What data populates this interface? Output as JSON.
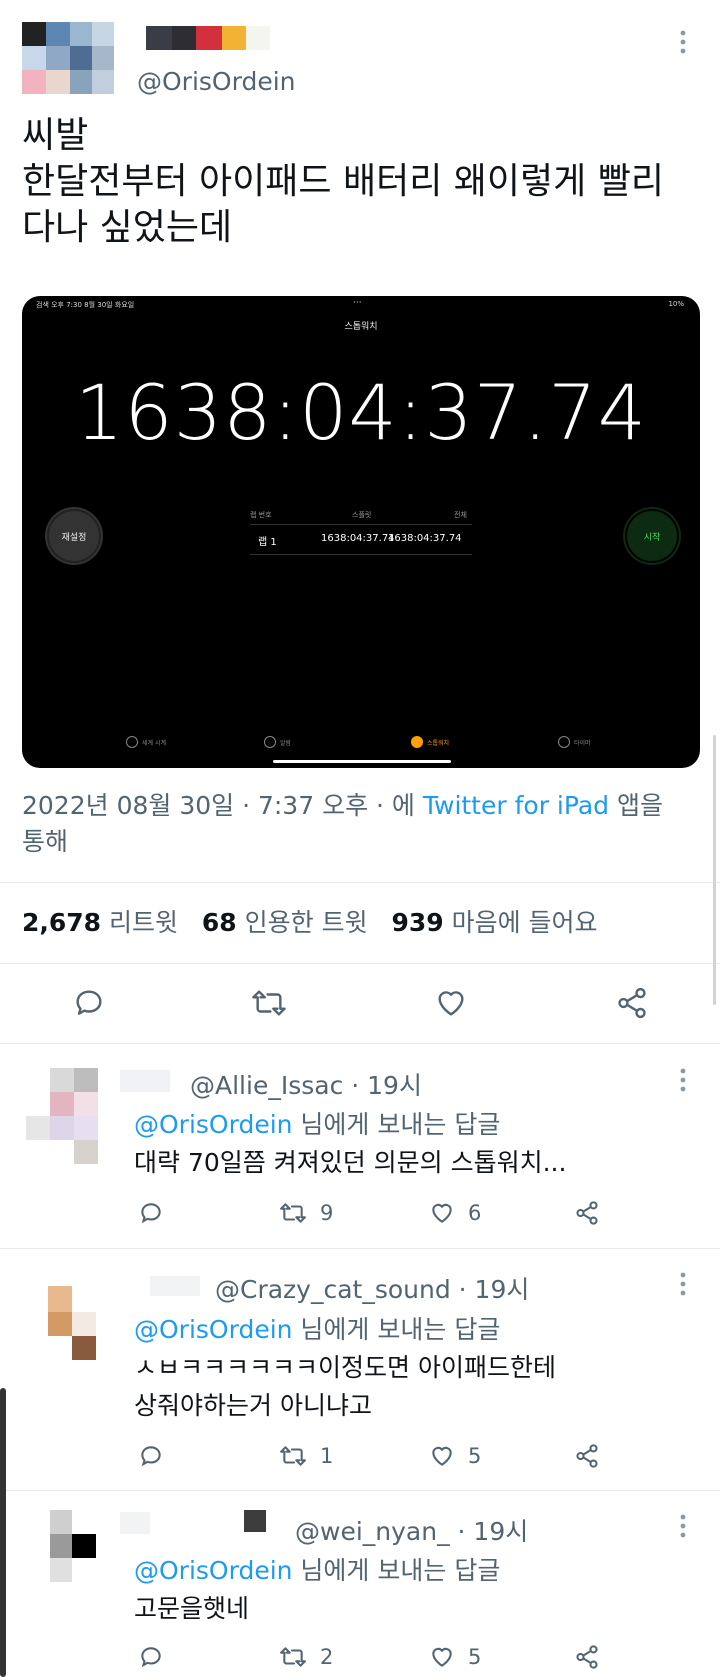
{
  "tweet": {
    "handle": "@OrisOrdein",
    "text_lines": [
      "씨발",
      "한달전부터 아이패드 배터리 왜이렇게 빨리",
      "다나 싶었는데"
    ],
    "media": {
      "status_left": "검색  오후 7:30  8월 30일 화요일",
      "status_center": "···",
      "status_right": "10%",
      "title": "스톱워치",
      "time": "1638:04:37.74",
      "reset_label": "재설정",
      "start_label": "시작",
      "lap_headers": [
        "랩 번호",
        "스플릿",
        "전체"
      ],
      "lap_row": {
        "lap": "랩 1",
        "split": "1638:04:37.74",
        "total": "1638:04:37.74"
      },
      "tabs": [
        {
          "label": "세계 시계",
          "icon": "globe-icon"
        },
        {
          "label": "알람",
          "icon": "alarm-icon"
        },
        {
          "label": "스톱워치",
          "icon": "stopwatch-icon"
        },
        {
          "label": "타이머",
          "icon": "timer-icon"
        }
      ]
    },
    "meta_prefix": "2022년 08월 30일 · 7:37 오후 · 에 ",
    "meta_source": "Twitter for iPad",
    "meta_suffix": " 앱을",
    "meta_line2": "통해",
    "stats": {
      "retweets": "2,678",
      "retweets_label": "리트윗",
      "quotes": "68",
      "quotes_label": "인용한 트윗",
      "likes": "939",
      "likes_label": "마음에 들어요"
    }
  },
  "replies": [
    {
      "handle": "@Allie_Issac · 19시",
      "reply_to": "@OrisOrdein",
      "reply_to_suffix": " 님에게 보내는 답글",
      "body_lines": [
        "대략 70일쯤 켜져있던 의문의 스톱워치..."
      ],
      "retweets": "9",
      "likes": "6"
    },
    {
      "handle": "@Crazy_cat_sound · 19시",
      "reply_to": "@OrisOrdein",
      "reply_to_suffix": " 님에게 보내는 답글",
      "body_lines": [
        "ㅅㅂㅋㅋㅋㅋㅋㅋ이정도면 아이패드한테",
        "상줘야하는거 아니냐고"
      ],
      "retweets": "1",
      "likes": "5"
    },
    {
      "handle": "@wei_nyan_ · 19시",
      "reply_to": "@OrisOrdein",
      "reply_to_suffix": " 님에게 보내는 답글",
      "body_lines": [
        "고문을햇네"
      ],
      "retweets": "2",
      "likes": "5"
    }
  ],
  "colors": {
    "accent": "#1d9bf0",
    "muted": "#536471",
    "text": "#0f1419"
  }
}
